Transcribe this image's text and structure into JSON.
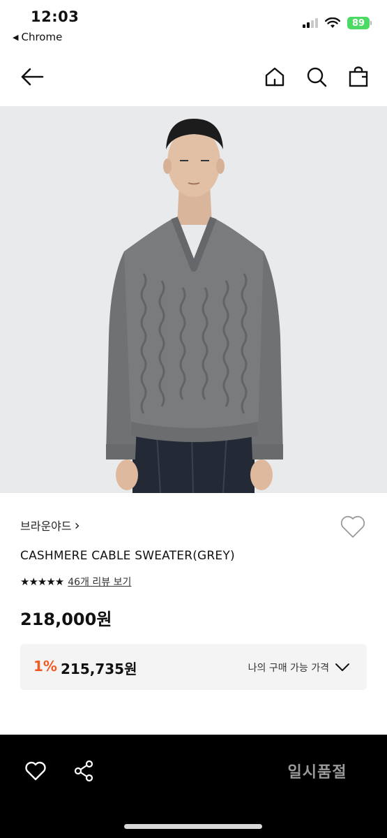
{
  "status_bar": {
    "time": "12:03",
    "back_app": "Chrome",
    "battery": "89"
  },
  "nav": {
    "icons": [
      "back-arrow-icon",
      "home-icon",
      "search-icon",
      "shopping-bag-icon"
    ]
  },
  "product": {
    "brand": "브라운야드",
    "brand_chevron": "›",
    "name": "CASHMERE CABLE SWEATER(GREY)",
    "rating_stars": "★★★★★",
    "rating_value": 5,
    "review_link": "46개 리뷰 보기",
    "price": "218,000원"
  },
  "my_price": {
    "discount": "1%",
    "price": "215,735원",
    "label": "나의 구매 가능 가격"
  },
  "bottom_bar": {
    "soldout_label": "일시품절"
  },
  "colors": {
    "accent_discount": "#f05a23",
    "bottom_bar_bg": "#000000",
    "battery_green": "#4cd964"
  }
}
